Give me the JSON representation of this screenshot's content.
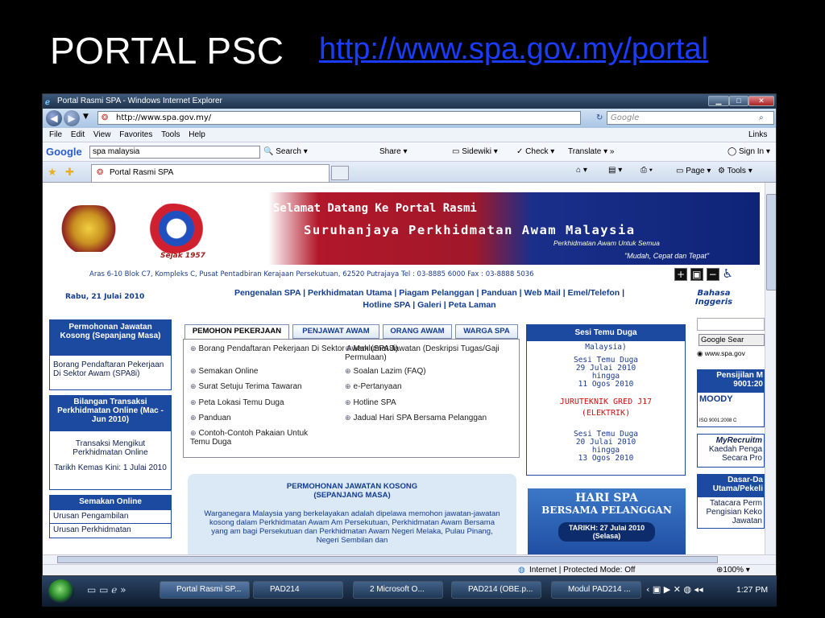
{
  "slide": {
    "title": "PORTAL PSC",
    "link": "http://www.spa.gov.my/portal"
  },
  "browser": {
    "window_title": "Portal Rasmi SPA - Windows Internet Explorer",
    "address": "http://www.spa.gov.my/",
    "search_placeholder": "Google",
    "menu": [
      "File",
      "Edit",
      "View",
      "Favorites",
      "Tools",
      "Help"
    ],
    "links_label": "Links",
    "google_toolbar": {
      "logo": "Google",
      "query": "spa malaysia",
      "search": "Search",
      "share": "Share",
      "sidewiki": "Sidewiki",
      "check": "Check",
      "translate": "Translate",
      "signin": "Sign In"
    },
    "tab_label": "Portal Rasmi SPA",
    "cmd": {
      "page": "Page",
      "tools": "Tools"
    },
    "status": {
      "zone": "Internet | Protected Mode: Off",
      "zoom": "100%"
    }
  },
  "site": {
    "banner_line1": "Selamat Datang Ke Portal Rasmi",
    "banner_line2": "Suruhanjaya Perkhidmatan Awam Malaysia",
    "banner_line3": "Perkhidmatan Awam Untuk Semua",
    "banner_line4": "\"Mudah, Cepat dan Tepat\"",
    "sejak": "Sejak 1957",
    "address": "Aras 6-10 Blok C7, Kompleks C, Pusat Pentadbiran Kerajaan Persekutuan, 62520 Putrajaya Tel : 03-8885 6000 Fax : 03-8888 5036",
    "date": "Rabu, 21 Julai 2010",
    "nav": [
      "Pengenalan SPA",
      "Perkhidmatan Utama",
      "Piagam Pelanggan",
      "Panduan",
      "Web Mail",
      "Emel/Telefon",
      "Hotline SPA",
      "Galeri",
      "Peta Laman"
    ],
    "lang": "Bahasa Inggeris",
    "left": {
      "box1_title": "Permohonan Jawatan Kosong (Sepanjang Masa)",
      "box1_body": "Borang Pendaftaran Pekerjaan Di Sektor Awam (SPA8i)",
      "box2_title": "Bilangan Transaksi Perkhidmatan Online (Mac - Jun 2010)",
      "box2_body1": "Transaksi Mengikut Perkhidmatan Online",
      "box2_body2": "Tarikh Kemas Kini: 1 Julai 2010",
      "box3_title": "Semakan Online",
      "box3_items": [
        "Urusan Pengambilan",
        "Urusan Perkhidmatan"
      ]
    },
    "tabs": [
      "PEMOHON PEKERJAAN",
      "PENJAWAT AWAM",
      "ORANG AWAM",
      "WARGA SPA"
    ],
    "links_col1": [
      "Borang Pendaftaran Pekerjaan Di Sektor Awam (SPA8i)",
      "Semakan Online",
      "Surat Setuju Terima Tawaran",
      "Peta Lokasi Temu Duga",
      "Panduan",
      "Contoh-Contoh Pakaian Untuk Temu Duga"
    ],
    "links_col2": [
      "Maklumat Jawatan (Deskripsi Tugas/Gaji Permulaan)",
      "Soalan Lazim (FAQ)",
      "e-Pertanyaan",
      "Hotline SPA",
      "Jadual Hari SPA Bersama Pelanggan"
    ],
    "notice_title": "PERMOHONAN JAWATAN KOSONG (SEPANJANG MASA)",
    "notice_body": "Warganegara Malaysia yang berkelayakan adalah dipelawa memohon jawatan-jawatan kosong dalam Perkhidmatan Awam Am Persekutuan, Perkhidmatan Awam Bersama yang am bagi Persekutuan dan Perkhidmatan Awam Negeri Melaka, Pulau Pinang, Negeri Sembilan dan",
    "sesi_title": "Sesi Temu Duga",
    "sesi_top": "Malaysia)",
    "sesi1": [
      "Sesi Temu Duga",
      "29 Julai 2010",
      "hingga",
      "11 Ogos 2010"
    ],
    "sesi_job": [
      "JURUTEKNIK GRED J17",
      "(ELEKTRIK)"
    ],
    "sesi2": [
      "Sesi Temu Duga",
      "20 Julai 2010",
      "hingga",
      "13 Ogos 2010"
    ],
    "hari_spa": [
      "HARI SPA",
      "BERSAMA PELANGGAN"
    ],
    "hari_date": "TARIKH: 27 Julai 2010",
    "hari_day": "(Selasa)",
    "right": {
      "search_btn": "Google Sear",
      "search_opt": "www.spa.gov",
      "cert_title": "Pensijilan M 9001:20",
      "cert_logo": "MOODY",
      "cert_iso": "ISO 9001:2008 C",
      "myrecruit": "MyRecruitm",
      "kaedah": "Kaedah Penga",
      "secara": "Secara Pro",
      "dasar": "Dasar-Da Utama/Pekeli",
      "tatacara": "Tatacara Perm",
      "pengisian": "Pengisian Keko Jawatan"
    }
  },
  "taskbar": {
    "items": [
      "Portal Rasmi SP...",
      "PAD214",
      "2 Microsoft O...",
      "PAD214 (OBE.p...",
      "Modul PAD214 ..."
    ],
    "time": "1:27 PM"
  }
}
